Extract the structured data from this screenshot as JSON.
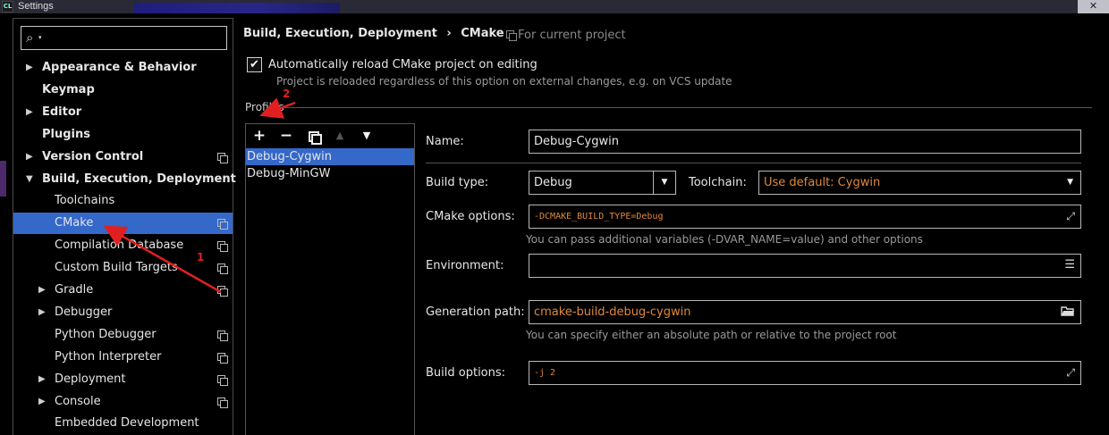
{
  "window": {
    "title": "Settings",
    "app_icon": "CL",
    "close_glyph": "✕"
  },
  "sidebar": {
    "search": {
      "value": "",
      "placeholder": ""
    },
    "items": [
      {
        "label": "Appearance & Behavior",
        "expanded": false,
        "has_arrow": true,
        "bold": true,
        "depth": 0,
        "project_icon": false
      },
      {
        "label": "Keymap",
        "has_arrow": false,
        "bold": true,
        "depth": 0,
        "project_icon": false
      },
      {
        "label": "Editor",
        "expanded": false,
        "has_arrow": true,
        "bold": true,
        "depth": 0,
        "project_icon": false
      },
      {
        "label": "Plugins",
        "has_arrow": false,
        "bold": true,
        "depth": 0,
        "project_icon": false
      },
      {
        "label": "Version Control",
        "expanded": false,
        "has_arrow": true,
        "bold": true,
        "depth": 0,
        "project_icon": true
      },
      {
        "label": "Build, Execution, Deployment",
        "expanded": true,
        "has_arrow": true,
        "bold": true,
        "depth": 0,
        "project_icon": false
      },
      {
        "label": "Toolchains",
        "has_arrow": false,
        "bold": false,
        "depth": 1,
        "project_icon": false
      },
      {
        "label": "CMake",
        "has_arrow": false,
        "bold": false,
        "depth": 1,
        "project_icon": true,
        "selected": true
      },
      {
        "label": "Compilation Database",
        "has_arrow": false,
        "bold": false,
        "depth": 1,
        "project_icon": true
      },
      {
        "label": "Custom Build Targets",
        "has_arrow": false,
        "bold": false,
        "depth": 1,
        "project_icon": true
      },
      {
        "label": "Gradle",
        "expanded": false,
        "has_arrow": true,
        "bold": false,
        "depth": 1,
        "project_icon": true
      },
      {
        "label": "Debugger",
        "expanded": false,
        "has_arrow": true,
        "bold": false,
        "depth": 1,
        "project_icon": false
      },
      {
        "label": "Python Debugger",
        "has_arrow": false,
        "bold": false,
        "depth": 1,
        "project_icon": true
      },
      {
        "label": "Python Interpreter",
        "has_arrow": false,
        "bold": false,
        "depth": 1,
        "project_icon": true
      },
      {
        "label": "Deployment",
        "expanded": false,
        "has_arrow": true,
        "bold": false,
        "depth": 1,
        "project_icon": true
      },
      {
        "label": "Console",
        "expanded": false,
        "has_arrow": true,
        "bold": false,
        "depth": 1,
        "project_icon": true
      },
      {
        "label": "Embedded Development",
        "has_arrow": false,
        "bold": false,
        "depth": 1,
        "project_icon": false
      }
    ]
  },
  "header": {
    "breadcrumb": [
      "Build, Execution, Deployment",
      "›",
      "CMake"
    ],
    "scope_note": "For current project"
  },
  "auto_reload": {
    "checked": true,
    "check_glyph": "✔",
    "label": "Automatically reload CMake project on editing",
    "hint": "Project is reloaded regardless of this option on external changes, e.g. on VCS update"
  },
  "profiles": {
    "section_label": "Profiles",
    "toolbar": {
      "add": "+",
      "remove": "−",
      "move_up": "▲",
      "move_down": "▼"
    },
    "items": [
      "Debug-Cygwin",
      "Debug-MinGW"
    ],
    "selected_index": 0
  },
  "form": {
    "name": {
      "label": "Name:",
      "value": "Debug-Cygwin"
    },
    "build_type": {
      "label": "Build type:",
      "value": "Debug"
    },
    "toolchain": {
      "label": "Toolchain:",
      "value": "Use default: Cygwin"
    },
    "cmake_options": {
      "label": "CMake options:",
      "value": "-DCMAKE_BUILD_TYPE=Debug",
      "hint": "You can pass additional variables (-DVAR_NAME=value) and other options"
    },
    "environment": {
      "label": "Environment:",
      "value": ""
    },
    "generation_path": {
      "label": "Generation path:",
      "value": "cmake-build-debug-cygwin",
      "hint": "You can specify either an absolute path or relative to the project root"
    },
    "build_options": {
      "label": "Build options:",
      "value": "-j 2"
    }
  },
  "icons": {
    "search": "🔍",
    "dropdown": "▼",
    "expand": "⤢",
    "list": "☰",
    "folder": "📂"
  },
  "annotations": {
    "marker_1": "1",
    "marker_2": "2",
    "color": "#e02020"
  },
  "colors": {
    "selection": "#3468c9",
    "accent_orange": "#e0883a",
    "background": "#000000"
  }
}
